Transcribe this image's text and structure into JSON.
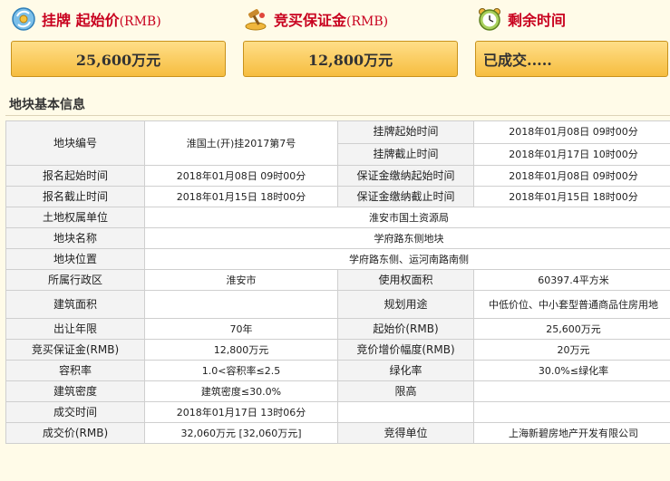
{
  "header": {
    "start_price_label": "挂牌  起始价",
    "start_price_unit": "(RMB)",
    "deposit_label": "竞买保证金",
    "deposit_unit": "(RMB)",
    "remaining_label": "剩余时间"
  },
  "summary": {
    "start_price": "25,600万元",
    "deposit": "12,800万元",
    "remaining": "已成交....."
  },
  "section": {
    "title": "地块基本信息"
  },
  "info": {
    "parcel_no_label": "地块编号",
    "parcel_no": "淮国土(开)挂2017第7号",
    "listing_start_label": "挂牌起始时间",
    "listing_start": "2018年01月08日 09时00分",
    "listing_end_label": "挂牌截止时间",
    "listing_end": "2018年01月17日 10时00分",
    "reg_start_label": "报名起始时间",
    "reg_start": "2018年01月08日 09时00分",
    "deposit_start_label": "保证金缴纳起始时间",
    "deposit_start": "2018年01月08日 09时00分",
    "reg_end_label": "报名截止时间",
    "reg_end": "2018年01月15日 18时00分",
    "deposit_end_label": "保证金缴纳截止时间",
    "deposit_end": "2018年01月15日 18时00分",
    "owner_label": "土地权属单位",
    "owner": "淮安市国土资源局",
    "name_label": "地块名称",
    "name": "学府路东侧地块",
    "location_label": "地块位置",
    "location": "学府路东侧、运河南路南侧",
    "district_label": "所属行政区",
    "district": "淮安市",
    "use_area_label": "使用权面积",
    "use_area": "60397.4平方米",
    "build_area_label": "建筑面积",
    "build_area": "",
    "planned_use_label": "规划用途",
    "planned_use": "中低价位、中小套型普通商品住房用地",
    "term_label": "出让年限",
    "term": "70年",
    "start_price_label": "起始价(RMB)",
    "start_price": "25,600万元",
    "deposit_label": "竞买保证金(RMB)",
    "deposit": "12,800万元",
    "increment_label": "竞价增价幅度(RMB)",
    "increment": "20万元",
    "far_label": "容积率",
    "far": "1.0<容积率≤2.5",
    "green_label": "绿化率",
    "green": "30.0%≤绿化率",
    "density_label": "建筑密度",
    "density": "建筑密度≤30.0%",
    "height_label": "限高",
    "height": "",
    "deal_time_label": "成交时间",
    "deal_time": "2018年01月17日 13时06分",
    "deal_price_label": "成交价(RMB)",
    "deal_price": "32,060万元 [32,060万元]",
    "winner_label": "竞得单位",
    "winner": "上海新碧房地产开发有限公司"
  },
  "colors": {
    "header_red": "#c8001e",
    "box_gold": "#f6bd3f",
    "label_cell": "#f3f3f3"
  },
  "icons": [
    "coin-exchange-icon",
    "gavel-deposit-icon",
    "alarm-clock-icon"
  ]
}
